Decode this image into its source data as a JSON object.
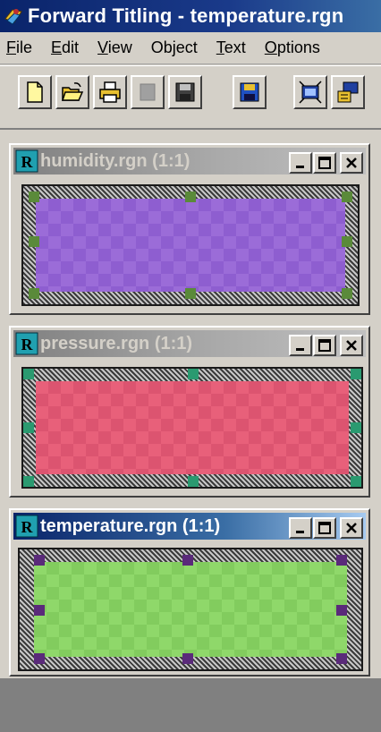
{
  "app": {
    "title": "Forward Titling - temperature.rgn",
    "icon": "app-logo-icon"
  },
  "menu": [
    {
      "label": "File",
      "underline": "F"
    },
    {
      "label": "Edit",
      "underline": "E"
    },
    {
      "label": "View",
      "underline": "V"
    },
    {
      "label": "Object",
      "underline": "j"
    },
    {
      "label": "Text",
      "underline": "T"
    },
    {
      "label": "Options",
      "underline": "O"
    }
  ],
  "toolbar": [
    {
      "name": "new-icon"
    },
    {
      "name": "open-icon"
    },
    {
      "name": "print-icon"
    },
    {
      "name": "disabled-icon"
    },
    {
      "name": "save-icon"
    },
    {
      "name": "save-as-icon"
    },
    {
      "name": "transmit-icon"
    },
    {
      "name": "export-icon"
    }
  ],
  "windows": [
    {
      "title": "humidity.rgn  (1:1)",
      "active": false,
      "region_color": "#9b6cd8",
      "region_color_alt": "#8e5ed0",
      "handle_color": "#5a8a3a",
      "hatch": "lavender"
    },
    {
      "title": "pressure.rgn  (1:1)",
      "active": false,
      "region_color": "#e8607a",
      "region_color_alt": "#dc5470",
      "handle_color": "#2a9a70",
      "hatch": "gray"
    },
    {
      "title": "temperature.rgn  (1:1)",
      "active": true,
      "region_color": "#8fd86a",
      "region_color_alt": "#82cc5e",
      "handle_color": "#5a2a7a",
      "hatch": "gray"
    }
  ],
  "colors": {
    "active_title": "#0a246a",
    "inactive_title": "#808080",
    "face": "#d4d0c8"
  }
}
